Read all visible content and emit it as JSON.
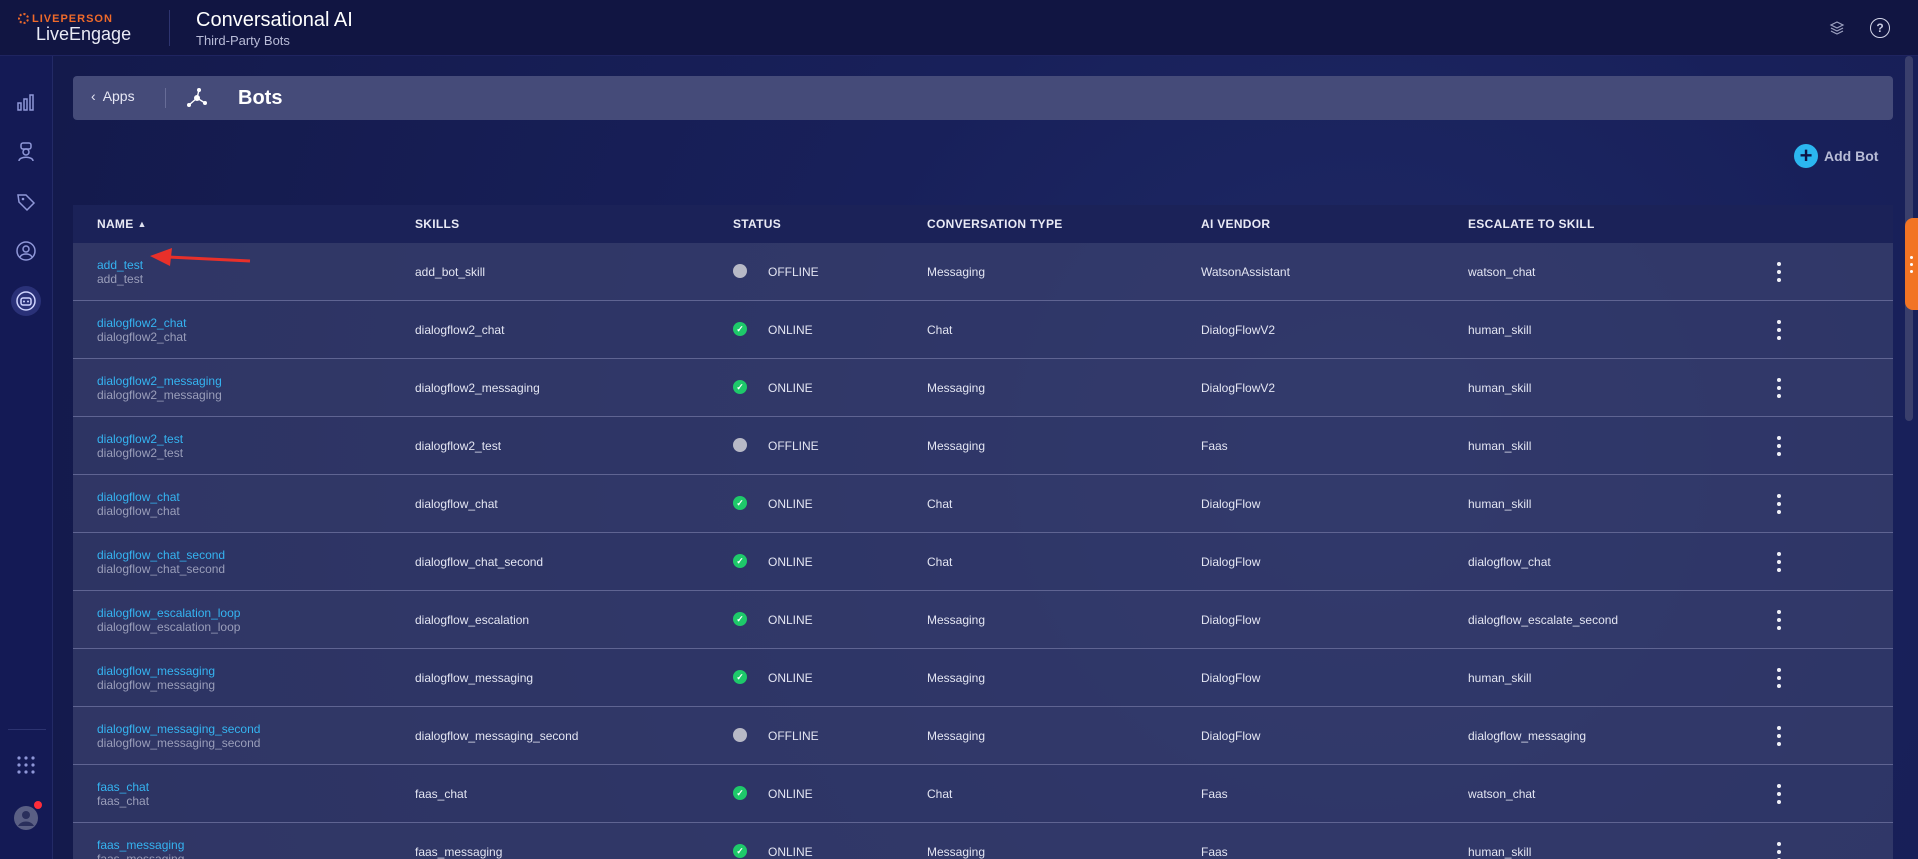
{
  "header": {
    "brand_top": "LIVEPERSON",
    "brand_main": "LiveEngage",
    "app_title": "Conversational AI",
    "app_subtitle": "Third-Party Bots",
    "icons": [
      "layers-icon",
      "help-icon"
    ],
    "help_glyph": "?"
  },
  "leftnav": {
    "items": [
      {
        "name": "analytics-icon"
      },
      {
        "name": "agent-icon"
      },
      {
        "name": "tag-icon"
      },
      {
        "name": "user-circle-icon"
      },
      {
        "name": "bot-icon",
        "active": true
      }
    ],
    "bottom": [
      "apps-grid-icon",
      "avatar"
    ]
  },
  "breadcrumb": {
    "back_label": "Apps",
    "title": "Bots"
  },
  "actions": {
    "add_label": "Add Bot",
    "add_glyph": "+"
  },
  "table": {
    "columns": [
      "NAME",
      "SKILLS",
      "STATUS",
      "CONVERSATION TYPE",
      "AI VENDOR",
      "ESCALATE TO SKILL"
    ],
    "rows": [
      {
        "name": "add_test",
        "sub": "add_test",
        "skill": "add_bot_skill",
        "status": "OFFLINE",
        "type": "Messaging",
        "vendor": "WatsonAssistant",
        "escalate": "watson_chat"
      },
      {
        "name": "dialogflow2_chat",
        "sub": "dialogflow2_chat",
        "skill": "dialogflow2_chat",
        "status": "ONLINE",
        "type": "Chat",
        "vendor": "DialogFlowV2",
        "escalate": "human_skill"
      },
      {
        "name": "dialogflow2_messaging",
        "sub": "dialogflow2_messaging",
        "skill": "dialogflow2_messaging",
        "status": "ONLINE",
        "type": "Messaging",
        "vendor": "DialogFlowV2",
        "escalate": "human_skill"
      },
      {
        "name": "dialogflow2_test",
        "sub": "dialogflow2_test",
        "skill": "dialogflow2_test",
        "status": "OFFLINE",
        "type": "Messaging",
        "vendor": "Faas",
        "escalate": "human_skill"
      },
      {
        "name": "dialogflow_chat",
        "sub": "dialogflow_chat",
        "skill": "dialogflow_chat",
        "status": "ONLINE",
        "type": "Chat",
        "vendor": "DialogFlow",
        "escalate": "human_skill"
      },
      {
        "name": "dialogflow_chat_second",
        "sub": "dialogflow_chat_second",
        "skill": "dialogflow_chat_second",
        "status": "ONLINE",
        "type": "Chat",
        "vendor": "DialogFlow",
        "escalate": "dialogflow_chat"
      },
      {
        "name": "dialogflow_escalation_loop",
        "sub": "dialogflow_escalation_loop",
        "skill": "dialogflow_escalation",
        "status": "ONLINE",
        "type": "Messaging",
        "vendor": "DialogFlow",
        "escalate": "dialogflow_escalate_second"
      },
      {
        "name": "dialogflow_messaging",
        "sub": "dialogflow_messaging",
        "skill": "dialogflow_messaging",
        "status": "ONLINE",
        "type": "Messaging",
        "vendor": "DialogFlow",
        "escalate": "human_skill"
      },
      {
        "name": "dialogflow_messaging_second",
        "sub": "dialogflow_messaging_second",
        "skill": "dialogflow_messaging_second",
        "status": "OFFLINE",
        "type": "Messaging",
        "vendor": "DialogFlow",
        "escalate": "dialogflow_messaging"
      },
      {
        "name": "faas_chat",
        "sub": "faas_chat",
        "skill": "faas_chat",
        "status": "ONLINE",
        "type": "Chat",
        "vendor": "Faas",
        "escalate": "watson_chat"
      },
      {
        "name": "faas_messaging",
        "sub": "faas_messaging",
        "skill": "faas_messaging",
        "status": "ONLINE",
        "type": "Messaging",
        "vendor": "Faas",
        "escalate": "human_skill"
      }
    ]
  },
  "colors": {
    "accent": "#35b4f1",
    "online": "#1ec96a",
    "offline": "#b7b9c6",
    "annotation": "#e8302a",
    "side_tab": "#f27424"
  }
}
